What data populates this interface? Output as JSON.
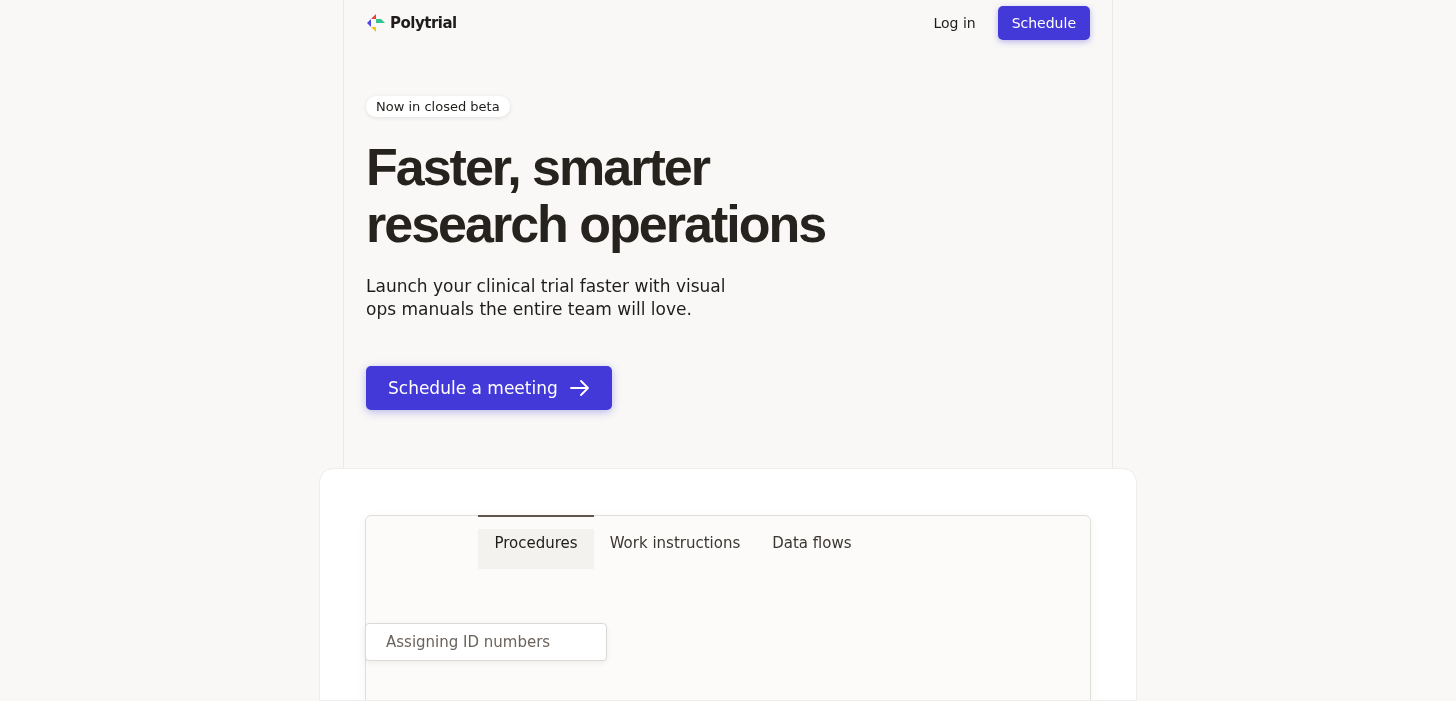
{
  "header": {
    "brand": "Polytrial",
    "login": "Log in",
    "cta": "Schedule"
  },
  "hero": {
    "badge": "Now in closed beta",
    "title_lines": [
      "Faster, smarter",
      "research operations"
    ],
    "subtitle_lines": [
      "Launch your clinical trial faster with visual",
      "ops manuals the entire team will love."
    ],
    "button": "Schedule a meeting"
  },
  "demo": {
    "tabs": [
      {
        "label": "Procedures",
        "selected": true
      },
      {
        "label": "Work instructions",
        "selected": false
      },
      {
        "label": "Data flows",
        "selected": false
      }
    ],
    "procedure": "Assigning ID numbers"
  }
}
